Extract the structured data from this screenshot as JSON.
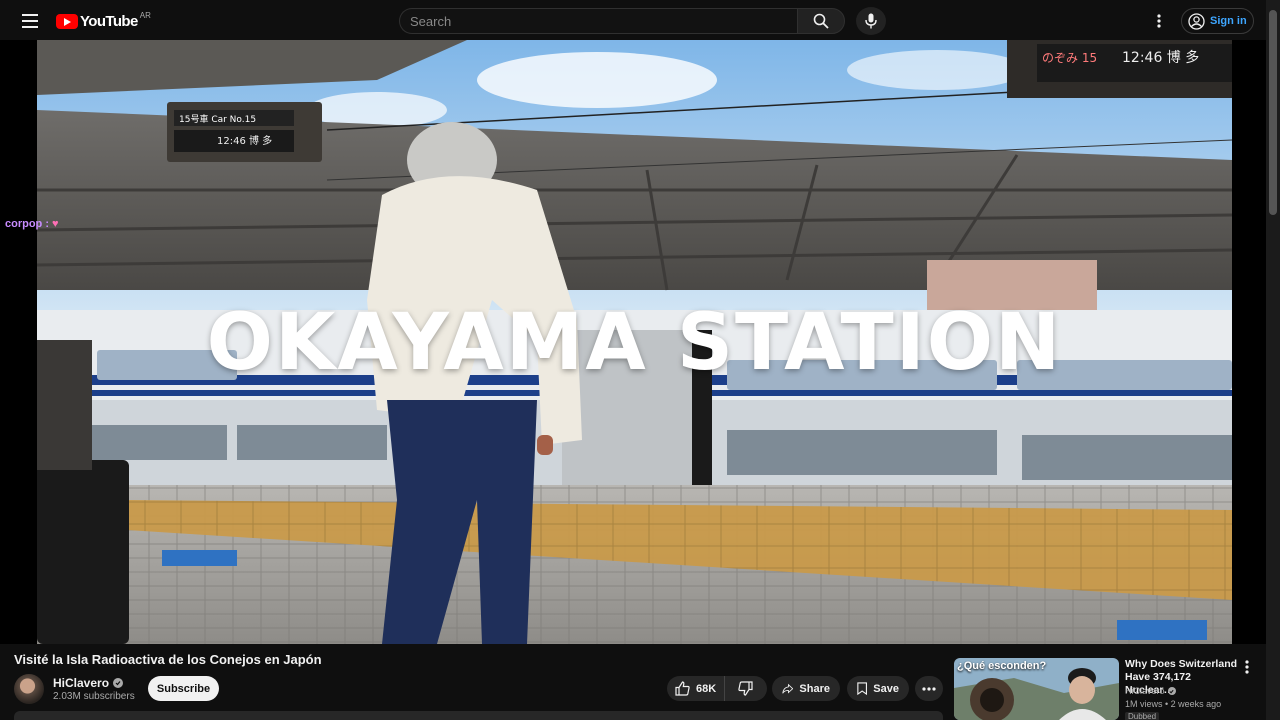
{
  "header": {
    "logo_text": "YouTube",
    "region": "AR",
    "search_placeholder": "Search",
    "signin_label": "Sign in"
  },
  "player": {
    "overlay_text": "OKAYAMA STATION",
    "chat_user": "corpop :",
    "scene_signs": {
      "left_car": "15号車 Car No.15",
      "left_time": "12:46",
      "right_name": "のぞみ",
      "right_num": "15",
      "right_time": "12:46 博 多"
    }
  },
  "video": {
    "title": "Visité la Isla Radioactiva de los Conejos en Japón",
    "channel": "HiClavero",
    "subscribers": "2.03M subscribers",
    "subscribe_label": "Subscribe",
    "likes": "68K",
    "share_label": "Share",
    "save_label": "Save"
  },
  "recommended": {
    "thumb_text": "¿Qué esconden?",
    "title": "Why Does Switzerland Have 374,172 Nuclear…",
    "channel": "HiClavero",
    "meta": "1M views • 2 weeks ago",
    "badge": "Dubbed"
  },
  "colors": {
    "background": "#0f0f0f",
    "brand_red": "#ff0000",
    "signin_blue": "#3ea6ff",
    "chip": "#272727"
  },
  "icons": [
    "menu-icon",
    "youtube-logo-icon",
    "search-icon",
    "mic-icon",
    "more-vert-icon",
    "account-icon",
    "verified-icon",
    "like-icon",
    "dislike-icon",
    "share-icon",
    "save-icon",
    "more-horiz-icon",
    "heart-icon"
  ]
}
